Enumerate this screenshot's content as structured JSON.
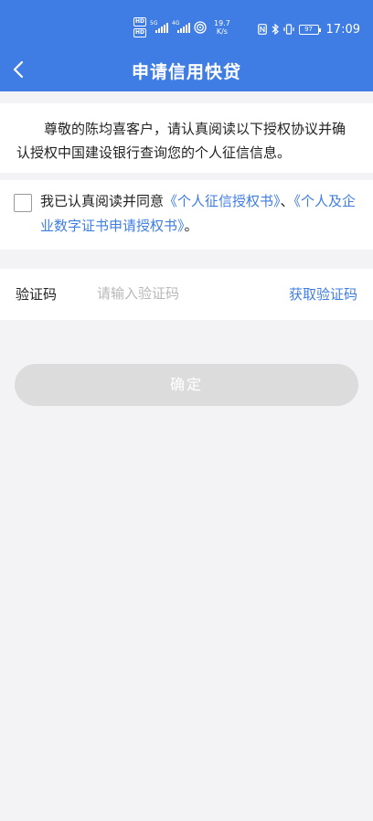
{
  "status_bar": {
    "hd1": "HD",
    "hd2": "HD",
    "network1": "5G",
    "network2": "4G",
    "speed_value": "19.7",
    "speed_unit": "K/s",
    "battery": "97",
    "time": "17:09"
  },
  "nav": {
    "title": "申请信用快贷"
  },
  "intro": {
    "text": "尊敬的陈均喜客户，请认真阅读以下授权协议并确认授权中国建设银行查询您的个人征信信息。"
  },
  "agreement": {
    "prefix": "我已认真阅读并同意",
    "link1": "《个人征信授权书》",
    "separator": "、",
    "link2": "《个人及企业数字证书申请授权书》",
    "suffix": "。",
    "checked": false
  },
  "verify": {
    "label": "验证码",
    "placeholder": "请输入验证码",
    "value": "",
    "get_code_label": "获取验证码"
  },
  "confirm": {
    "label": "确定",
    "enabled": false
  },
  "colors": {
    "primary": "#3f7de4",
    "background": "#f3f3f5",
    "disabled_button": "#dcdcdc"
  }
}
